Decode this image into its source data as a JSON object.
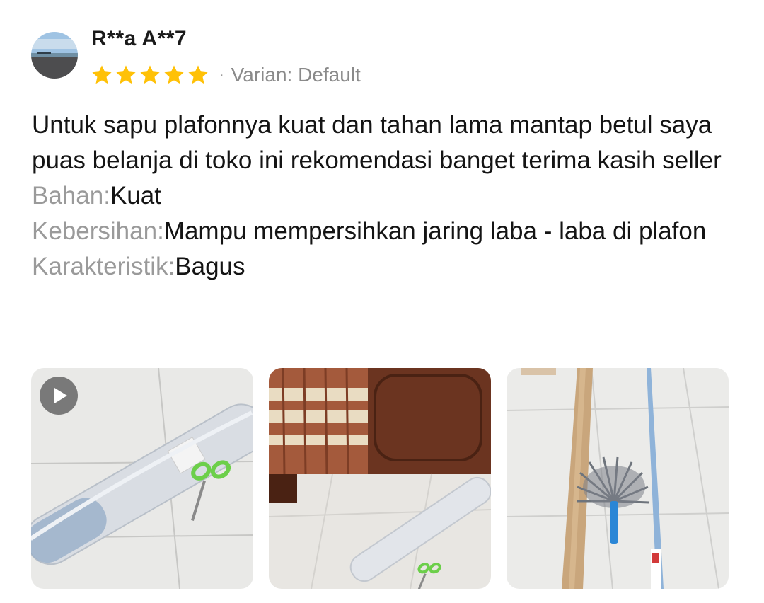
{
  "review": {
    "username": "R**a A**7",
    "rating": 5,
    "rating_max": 5,
    "separator": "·",
    "variant_label": "Varian: Default",
    "body": "Untuk sapu plafonnya kuat dan tahan lama mantap betul saya puas belanja di toko ini rekomendasi banget terima kasih seller",
    "attributes": [
      {
        "key": "Bahan:",
        "value": "Kuat"
      },
      {
        "key": "Kebersihan:",
        "value": "Mampu mempersihkan jaring laba - laba di plafon"
      },
      {
        "key": "Karakteristik:",
        "value": "Bagus"
      }
    ]
  },
  "colors": {
    "star": "#FFC107",
    "muted_text": "#8a8a8a",
    "body_text": "#141414"
  },
  "media": [
    {
      "kind": "video",
      "icon": "play-icon"
    },
    {
      "kind": "image"
    },
    {
      "kind": "image"
    }
  ]
}
